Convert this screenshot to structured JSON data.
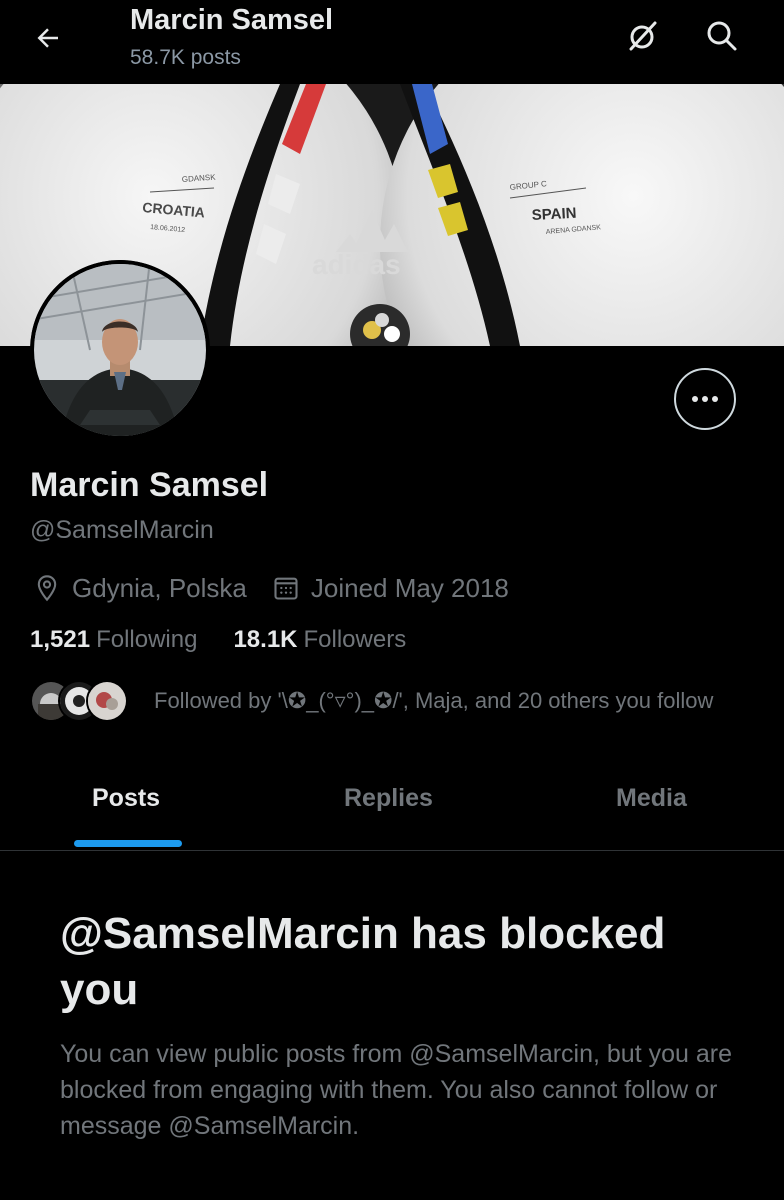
{
  "header": {
    "name": "Marcin Samsel",
    "posts_count": "58.7K posts",
    "back_icon": "arrow-left-icon",
    "icons": [
      "grok-slash-icon",
      "search-icon"
    ]
  },
  "banner": {
    "ball_left_team": "CROATIA",
    "ball_left_venue": "GDANSK",
    "ball_left_date": "18.06.2012",
    "ball_right_group": "GROUP C",
    "ball_right_team": "SPAIN",
    "ball_right_venue": "ARENA GDANSK",
    "brand": "adidas"
  },
  "profile": {
    "display_name": "Marcin Samsel",
    "handle": "@SamselMarcin",
    "location": "Gdynia, Polska",
    "joined": "Joined May 2018",
    "following_count": "1,521",
    "following_label": "Following",
    "followers_count": "18.1K",
    "followers_label": "Followers",
    "followed_by": "Followed by '\\✪_(°▿°)_✪/', Maja, and 20 others you follow"
  },
  "tabs": [
    {
      "label": "Posts",
      "active": true
    },
    {
      "label": "Replies",
      "active": false
    },
    {
      "label": "Media",
      "active": false
    }
  ],
  "blocked": {
    "title": "@SamselMarcin has blocked you",
    "message": "You can view public posts from @SamselMarcin, but you are blocked from engaging with them. You also cannot follow or message @SamselMarcin."
  },
  "colors": {
    "background": "#000000",
    "primary_text": "#e7e9ea",
    "secondary_text": "#71767b",
    "accent": "#1d9bf0"
  }
}
